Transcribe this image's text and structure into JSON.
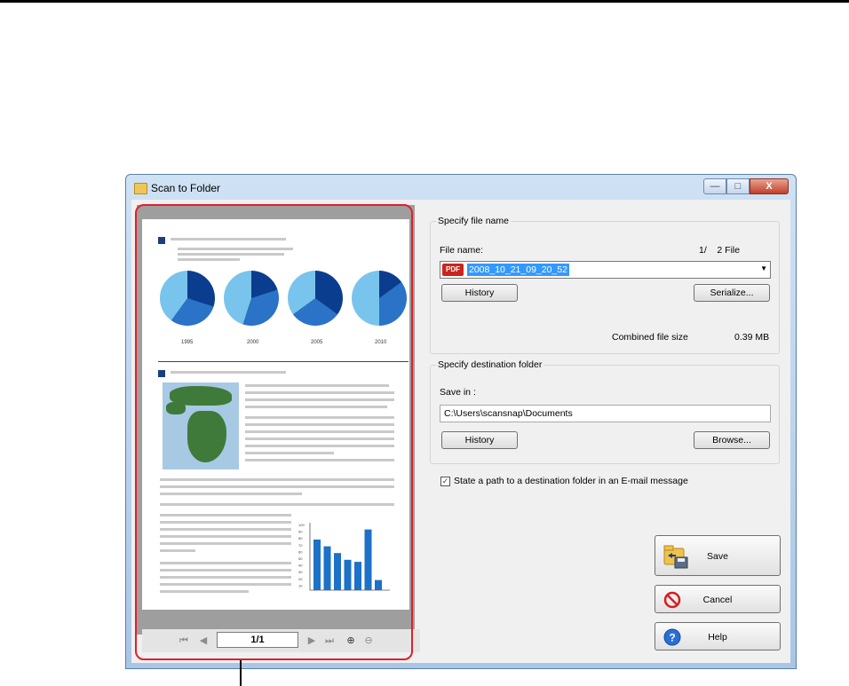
{
  "window": {
    "title": "Scan to Folder"
  },
  "title_buttons": {
    "minimize": "—",
    "maximize": "□",
    "close": "X"
  },
  "preview": {
    "years": [
      "1995",
      "2000",
      "2005",
      "2010"
    ],
    "pager": {
      "page_indicator": "1/1"
    },
    "chart": {
      "y_ticks": [
        "100",
        "90",
        "80",
        "70",
        "60",
        "50",
        "40",
        "30",
        "20",
        "10"
      ],
      "bars": [
        75,
        65,
        55,
        45,
        42,
        90,
        15
      ]
    }
  },
  "file_name_group": {
    "title": "Specify file name",
    "file_name_label": "File name:",
    "counter": "1/    2 File",
    "file_badge": "PDF",
    "file_value": "2008_10_21_09_20_52",
    "history_button": "History",
    "serialize_button": "Serialize...",
    "combined_label": "Combined file size",
    "combined_value": "0.39 MB"
  },
  "dest_group": {
    "title": "Specify destination folder",
    "save_in_label": "Save in :",
    "path_value": "C:\\Users\\scansnap\\Documents",
    "history_button": "History",
    "browse_button": "Browse..."
  },
  "email_option": {
    "checked": true,
    "label": "State a path to a destination folder in an E-mail message"
  },
  "actions": {
    "save": "Save",
    "cancel": "Cancel",
    "help": "Help"
  }
}
